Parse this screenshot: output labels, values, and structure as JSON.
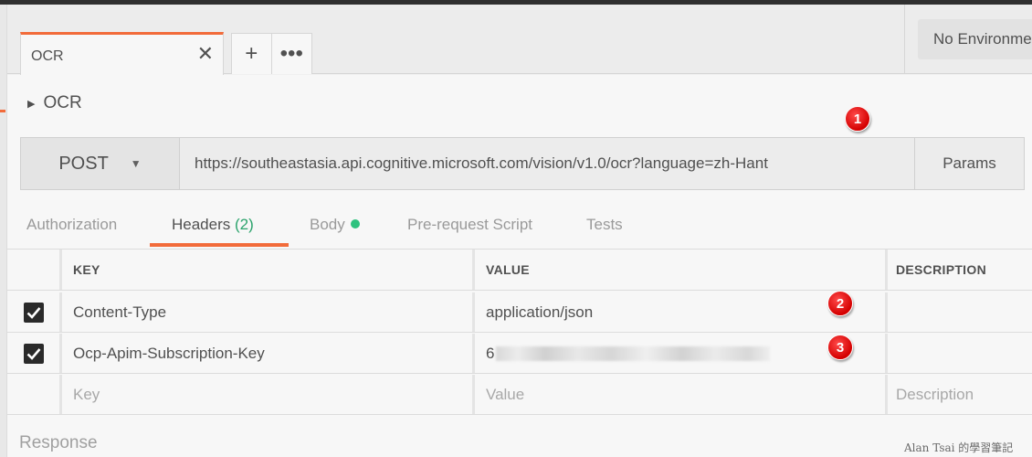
{
  "tabs": [
    {
      "label": "OCR",
      "close_icon": "close-icon"
    }
  ],
  "tab_actions": {
    "new_tab_icon": "plus-icon",
    "more_icon": "more-horizontal-icon"
  },
  "environment": {
    "selected": "No Environment"
  },
  "request": {
    "name": "OCR",
    "method": "POST",
    "url": "https://southeastasia.api.cognitive.microsoft.com/vision/v1.0/ocr?language=zh-Hant",
    "params_label": "Params"
  },
  "subtabs": {
    "authorization": "Authorization",
    "headers": "Headers",
    "headers_count": "(2)",
    "body": "Body",
    "prerequest": "Pre-request Script",
    "tests": "Tests"
  },
  "headers_table": {
    "columns": [
      "KEY",
      "VALUE",
      "DESCRIPTION"
    ],
    "rows": [
      {
        "checked": true,
        "key": "Content-Type",
        "value": "application/json",
        "description": ""
      },
      {
        "checked": true,
        "key": "Ocp-Apim-Subscription-Key",
        "value": "6",
        "description": ""
      }
    ],
    "placeholders": {
      "key": "Key",
      "value": "Value",
      "description": "Description"
    }
  },
  "annotations": [
    "1",
    "2",
    "3"
  ],
  "response_label": "Response",
  "watermark": "Alan Tsai 的學習筆記",
  "colors": {
    "accent": "#f26b3a",
    "count_green": "#2ba36c",
    "badge_red": "#e00000"
  }
}
